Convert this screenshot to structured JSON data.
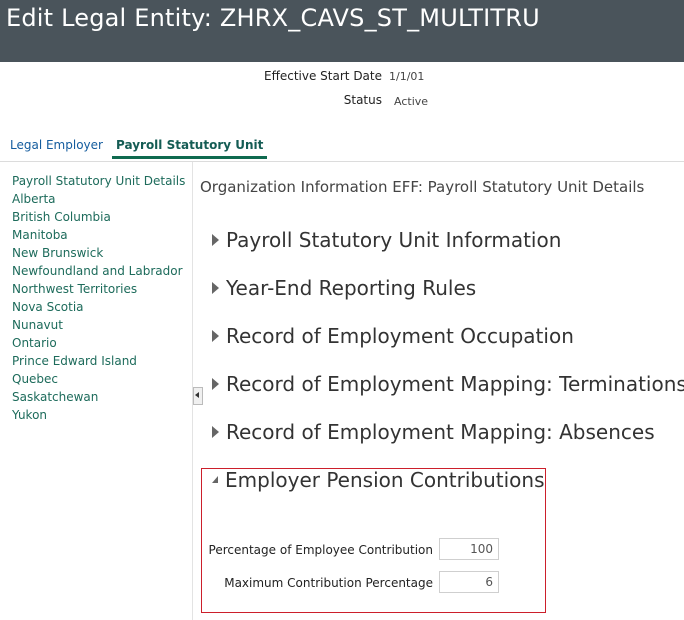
{
  "header": {
    "title": "Edit Legal Entity: ZHRX_CAVS_ST_MULTITRU"
  },
  "meta": {
    "effective_start_date_label": "Effective Start Date",
    "effective_start_date_value": "1/1/01",
    "status_label": "Status",
    "status_value": "Active"
  },
  "tabs": [
    {
      "label": "Legal Employer",
      "active": false
    },
    {
      "label": "Payroll Statutory Unit",
      "active": true
    }
  ],
  "sidebar": {
    "items": [
      "Payroll Statutory Unit Details",
      "Alberta",
      "British Columbia",
      "Manitoba",
      "New Brunswick",
      "Newfoundland and Labrador",
      "Northwest Territories",
      "Nova Scotia",
      "Nunavut",
      "Ontario",
      "Prince Edward Island",
      "Quebec",
      "Saskatchewan",
      "Yukon"
    ]
  },
  "main": {
    "section_title": "Organization Information EFF: Payroll Statutory Unit Details",
    "accordions": [
      {
        "label": "Payroll Statutory Unit Information",
        "expanded": false
      },
      {
        "label": "Year-End Reporting Rules",
        "expanded": false
      },
      {
        "label": "Record of Employment Occupation",
        "expanded": false
      },
      {
        "label": "Record of Employment Mapping: Terminations",
        "expanded": false
      },
      {
        "label": "Record of Employment Mapping: Absences",
        "expanded": false
      },
      {
        "label": "Employer Pension Contributions",
        "expanded": true
      }
    ],
    "fields": {
      "employee_contribution_label": "Percentage of Employee Contribution",
      "employee_contribution_value": "100",
      "max_contribution_label": "Maximum Contribution Percentage",
      "max_contribution_value": "6"
    }
  },
  "colors": {
    "header_bg": "#4a545b",
    "link": "#1d6b5b",
    "highlight_border": "#cc1f2b"
  }
}
